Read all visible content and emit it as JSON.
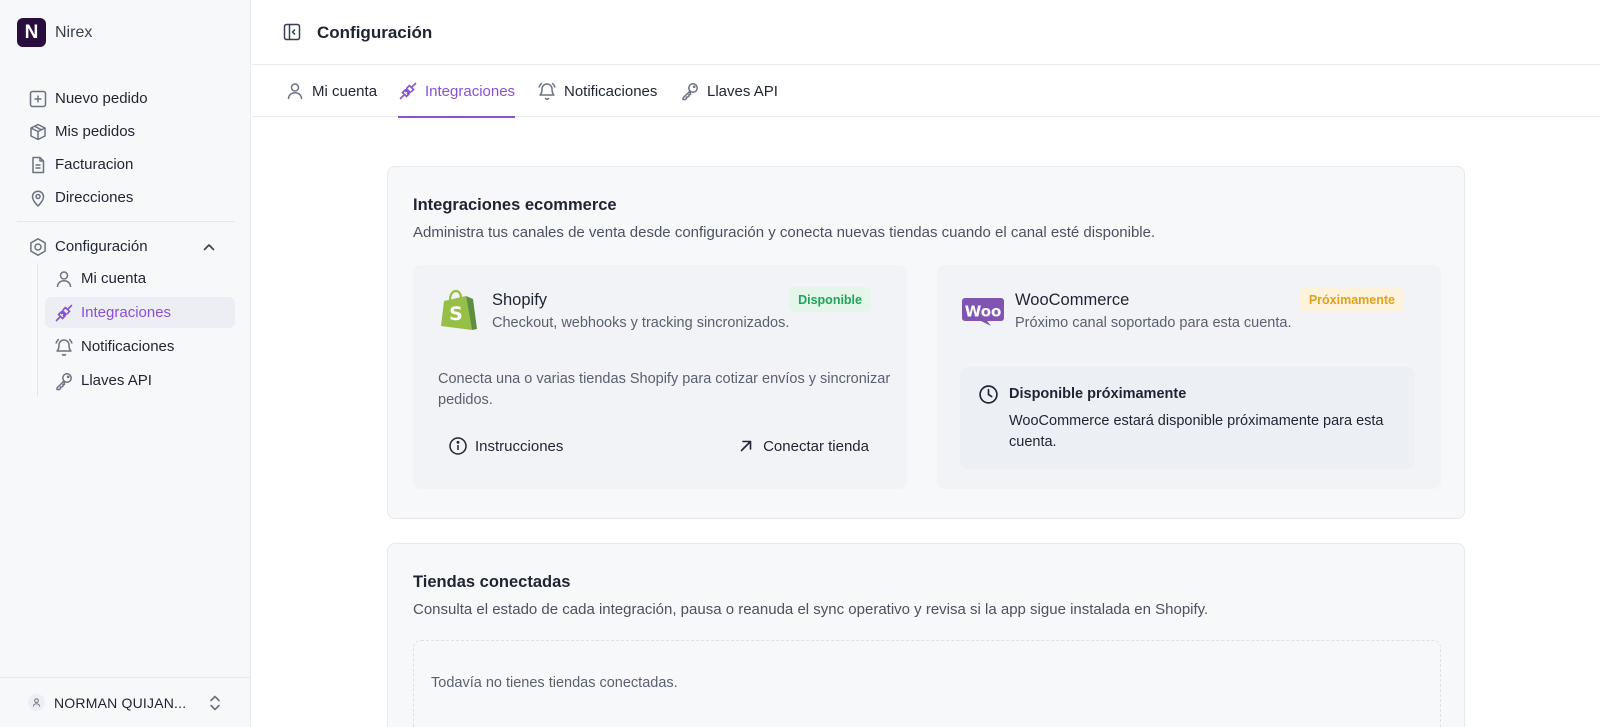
{
  "app": {
    "logo_letter": "N",
    "name": "Nirex"
  },
  "sidebar": {
    "items": [
      {
        "label": "Nuevo pedido",
        "icon": "plus-square-icon"
      },
      {
        "label": "Mis pedidos",
        "icon": "box-icon"
      },
      {
        "label": "Facturacion",
        "icon": "document-icon"
      },
      {
        "label": "Direcciones",
        "icon": "map-pin-icon"
      }
    ],
    "config_group": {
      "label": "Configuración",
      "icon": "settings-icon",
      "expanded": true,
      "children": [
        {
          "label": "Mi cuenta",
          "icon": "user-icon"
        },
        {
          "label": "Integraciones",
          "icon": "plug-icon",
          "active": true
        },
        {
          "label": "Notificaciones",
          "icon": "bell-icon"
        },
        {
          "label": "Llaves API",
          "icon": "key-icon"
        }
      ]
    },
    "user": {
      "name": "NORMAN QUIJAN..."
    }
  },
  "header": {
    "title": "Configuración"
  },
  "tabs": [
    {
      "label": "Mi cuenta",
      "icon": "user-icon"
    },
    {
      "label": "Integraciones",
      "icon": "plug-icon",
      "active": true
    },
    {
      "label": "Notificaciones",
      "icon": "bell-icon"
    },
    {
      "label": "Llaves API",
      "icon": "key-icon"
    }
  ],
  "integrations": {
    "title": "Integraciones ecommerce",
    "description": "Administra tus canales de venta desde configuración y conecta nuevas tiendas cuando el canal esté disponible.",
    "shopify": {
      "name": "Shopify",
      "subtitle": "Checkout, webhooks y tracking sincronizados.",
      "badge": "Disponible",
      "text": "Conecta una o varias tiendas Shopify para cotizar envíos y sincronizar pedidos.",
      "instructions_label": "Instrucciones",
      "connect_label": "Conectar tienda"
    },
    "woocommerce": {
      "name": "WooCommerce",
      "logo_text": "Woo",
      "subtitle": "Próximo canal soportado para esta cuenta.",
      "badge": "Próximamente",
      "soon_title": "Disponible próximamente",
      "soon_text": "WooCommerce estará disponible próximamente para esta cuenta."
    }
  },
  "stores": {
    "title": "Tiendas conectadas",
    "description": "Consulta el estado de cada integración, pausa o reanuda el sync operativo y revisa si la app sigue instalada en Shopify.",
    "empty_text": "Todavía no tienes tiendas conectadas."
  },
  "colors": {
    "accent": "#8b4fd6",
    "brand_logo_bg": "#2a0d3f",
    "available_green": "#22a35a",
    "soon_amber": "#e0a11b",
    "shopify_green": "#95bf47",
    "woo_purple": "#7f54b3"
  }
}
